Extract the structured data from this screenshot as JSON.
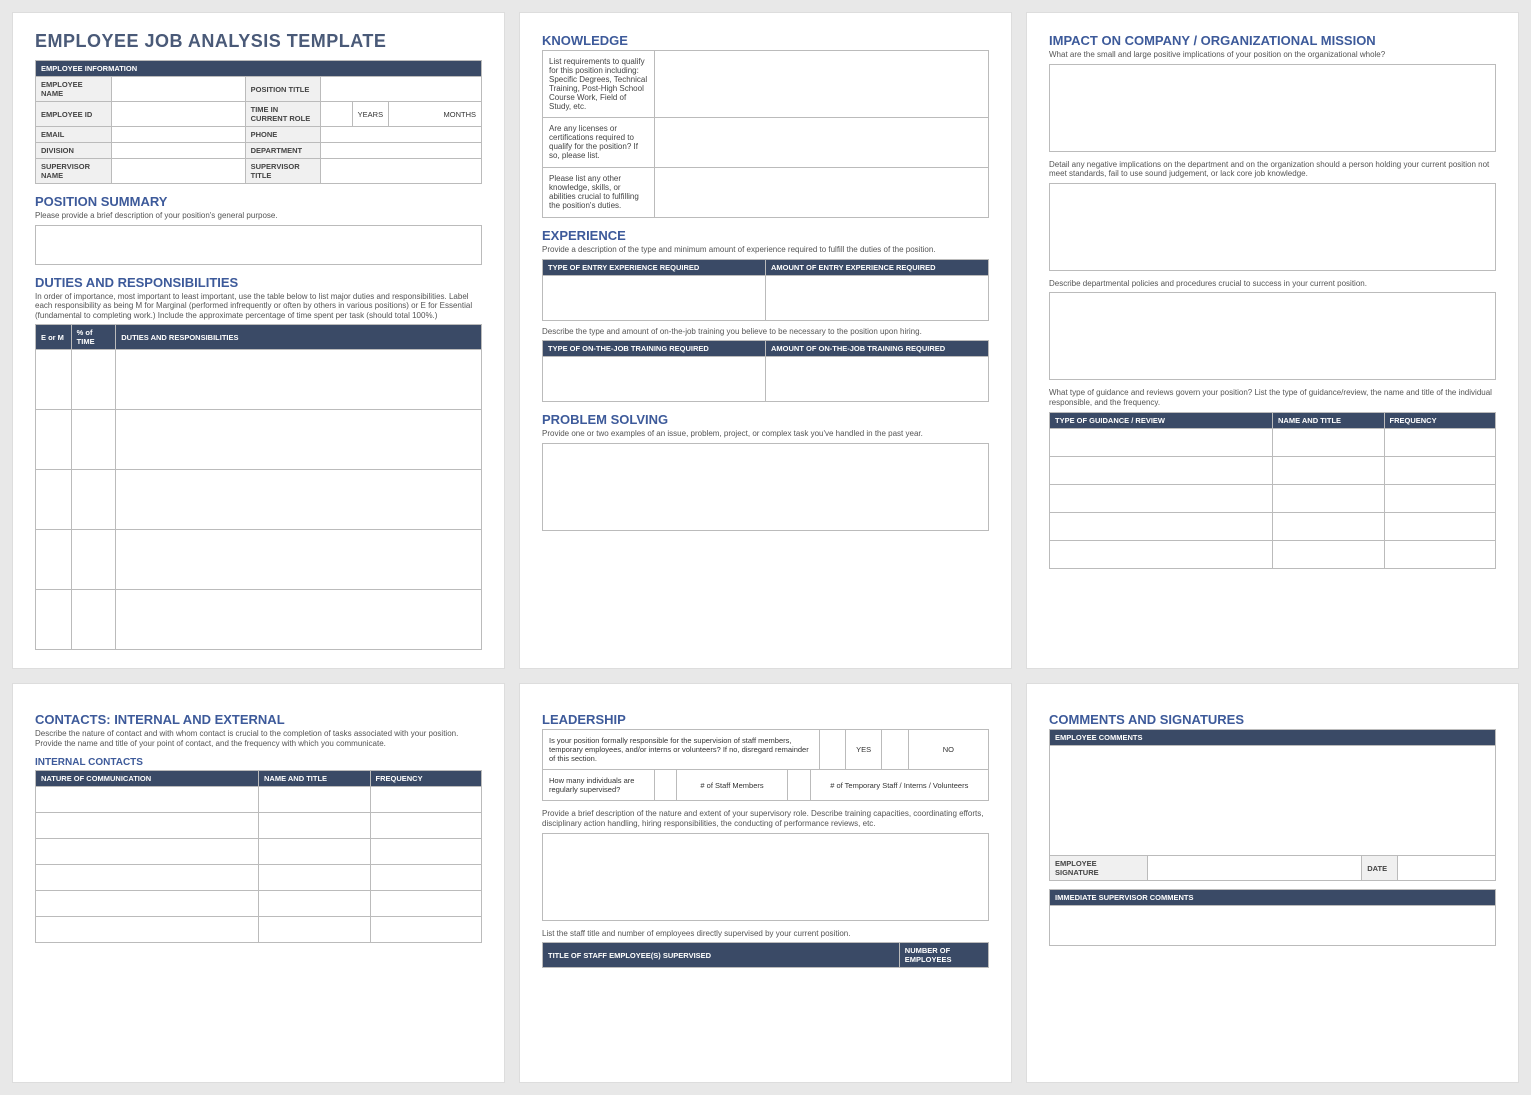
{
  "page1": {
    "title": "EMPLOYEE JOB ANALYSIS TEMPLATE",
    "emp_info_hdr": "EMPLOYEE INFORMATION",
    "fields": {
      "emp_name": "EMPLOYEE NAME",
      "pos_title": "POSITION TITLE",
      "emp_id": "EMPLOYEE ID",
      "time_role": "TIME IN CURRENT ROLE",
      "years": "YEARS",
      "months": "MONTHS",
      "email": "EMAIL",
      "phone": "PHONE",
      "division": "DIVISION",
      "department": "DEPARTMENT",
      "supervisor": "SUPERVISOR NAME",
      "sup_title": "SUPERVISOR TITLE"
    },
    "pos_summary": {
      "title": "POSITION SUMMARY",
      "desc": "Please provide a brief description of your position's general purpose."
    },
    "duties": {
      "title": "DUTIES AND RESPONSIBILITIES",
      "desc": "In order of importance, most important to least important, use the table below to list major duties and responsibilities. Label each responsibility as being M for Marginal (performed infrequently or often by others in various positions) or E for Essential (fundamental to completing work.) Include the approximate percentage of time spent per task (should total 100%.)",
      "h1": "E or M",
      "h2": "% of TIME",
      "h3": "DUTIES AND RESPONSIBILITIES"
    }
  },
  "page2": {
    "knowledge": {
      "title": "KNOWLEDGE",
      "q1": "List requirements to qualify for this position including: Specific Degrees, Technical Training, Post-High School Course Work, Field of Study, etc.",
      "q2": "Are any licenses or certifications required to qualify for the position? If so, please list.",
      "q3": "Please list any other knowledge, skills, or abilities crucial to fulfilling the position's duties."
    },
    "experience": {
      "title": "EXPERIENCE",
      "desc": "Provide a description of the type and minimum amount of experience required to fulfill the duties of the position.",
      "h1": "TYPE OF ENTRY EXPERIENCE REQUIRED",
      "h2": "AMOUNT OF ENTRY EXPERIENCE REQUIRED",
      "desc2": "Describe the type and amount of on-the-job training you believe to be necessary to the position upon hiring.",
      "h3": "TYPE OF ON-THE-JOB TRAINING REQUIRED",
      "h4": "AMOUNT OF ON-THE-JOB TRAINING REQUIRED"
    },
    "problem": {
      "title": "PROBLEM SOLVING",
      "desc": "Provide one or two examples of an issue, problem, project, or complex task you've handled in the past year."
    }
  },
  "page3": {
    "impact": {
      "title": "IMPACT ON COMPANY / ORGANIZATIONAL MISSION",
      "q1": "What are the small and large positive implications of your position on the organizational whole?",
      "q2": "Detail any negative implications on the department and on the organization should a person holding your current position not meet standards, fail to use sound judgement, or lack core job knowledge.",
      "q3": "Describe departmental policies and procedures crucial to success in your current position.",
      "q4": "What type of guidance and reviews govern your position?  List the type of guidance/review, the name and title of the individual responsible, and the frequency.",
      "h1": "TYPE OF GUIDANCE / REVIEW",
      "h2": "NAME AND TITLE",
      "h3": "FREQUENCY"
    }
  },
  "page4": {
    "contacts": {
      "title": "CONTACTS: INTERNAL AND EXTERNAL",
      "desc": "Describe the nature of contact and with whom contact is crucial to the completion of tasks associated with your position. Provide the name and title of your point of contact, and the frequency with which you communicate.",
      "internal": "INTERNAL CONTACTS",
      "h1": "NATURE OF COMMUNICATION",
      "h2": "NAME AND TITLE",
      "h3": "FREQUENCY"
    }
  },
  "page5": {
    "leadership": {
      "title": "LEADERSHIP",
      "q1": "Is your position formally responsible for the supervision of staff members, temporary employees, and/or interns or volunteers? If no, disregard remainder of this section.",
      "yes": "YES",
      "no": "NO",
      "q2": "How many individuals are regularly supervised?",
      "staff": "# of Staff Members",
      "temp": "# of Temporary Staff / Interns / Volunteers",
      "desc": "Provide a brief description of the nature and extent of your supervisory role.  Describe training capacities, coordinating efforts, disciplinary action handling, hiring responsibilities, the conducting of performance reviews, etc.",
      "desc2": "List the staff title and number of employees directly supervised by your current position.",
      "h1": "TITLE OF STAFF EMPLOYEE(S) SUPERVISED",
      "h2": "NUMBER OF EMPLOYEES"
    }
  },
  "page6": {
    "title": "COMMENTS AND SIGNATURES",
    "emp_comments": "EMPLOYEE COMMENTS",
    "emp_sig": "EMPLOYEE SIGNATURE",
    "date": "DATE",
    "sup_comments": "IMMEDIATE SUPERVISOR COMMENTS"
  }
}
